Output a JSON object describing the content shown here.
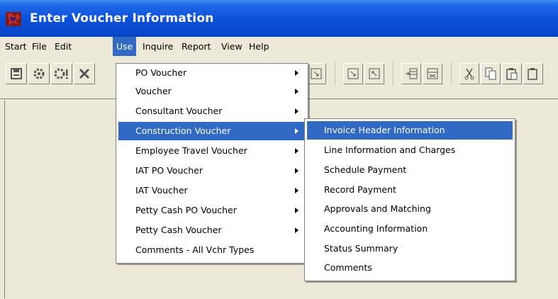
{
  "window": {
    "title": "Enter Voucher Information"
  },
  "menubar": {
    "items": [
      "Start",
      "File",
      "Edit",
      "Use",
      "Inquire",
      "Report",
      "View",
      "Help"
    ],
    "active": "Use"
  },
  "use_menu": {
    "items": [
      {
        "label": "PO Voucher",
        "has_submenu": true
      },
      {
        "label": "Voucher",
        "has_submenu": true
      },
      {
        "label": "Consultant Voucher",
        "has_submenu": true
      },
      {
        "label": "Construction Voucher",
        "has_submenu": true,
        "highlighted": true
      },
      {
        "label": "Employee Travel Voucher",
        "has_submenu": true
      },
      {
        "label": "IAT PO Voucher",
        "has_submenu": true
      },
      {
        "label": "IAT Voucher",
        "has_submenu": true
      },
      {
        "label": "Petty Cash PO Voucher",
        "has_submenu": true
      },
      {
        "label": "Petty Cash Voucher",
        "has_submenu": true
      },
      {
        "label": "Comments - All Vchr Types",
        "has_submenu": false
      }
    ]
  },
  "construction_submenu": {
    "items": [
      {
        "label": "Invoice Header Information",
        "highlighted": true
      },
      {
        "label": "Line Information and Charges"
      },
      {
        "label": "Schedule Payment"
      },
      {
        "label": "Record Payment"
      },
      {
        "label": "Approvals and Matching"
      },
      {
        "label": "Accounting Information"
      },
      {
        "label": "Status Summary"
      },
      {
        "label": "Comments"
      }
    ]
  },
  "colors": {
    "titlebar": "#0a50d8",
    "highlight": "#316ac5",
    "menu_bg": "#ffffff",
    "chrome": "#ece9d8"
  }
}
